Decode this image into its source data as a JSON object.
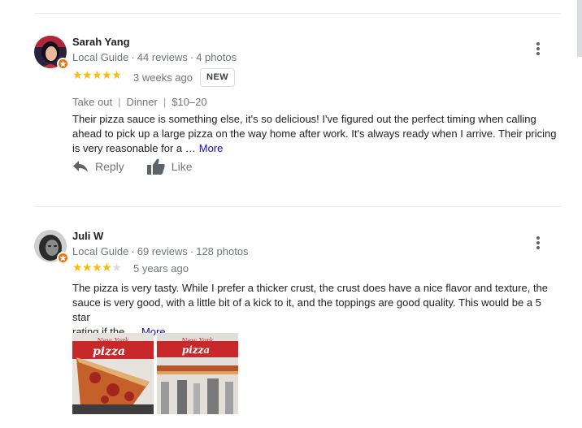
{
  "reviews": [
    {
      "name": "Sarah Yang",
      "role": "Local Guide",
      "reviews": "44 reviews",
      "photos": "4 photos",
      "stars": 5,
      "stars_text": "★★★★★",
      "age": "3 weeks ago",
      "badge": "NEW",
      "tags": [
        "Take out",
        "Dinner",
        "$10–20"
      ],
      "text_lines": [
        "Their pizza sauce is something else, it's so delicious! I've figured out the perfect timing when calling",
        "ahead to pick up a large pizza on the way home after work. It's always ready when I arrive. Their pricing",
        "is very reasonable for a …"
      ],
      "more": "More",
      "reply_label": "Reply",
      "like_label": "Like"
    },
    {
      "name": "Juli W",
      "role": "Local Guide",
      "reviews": "69 reviews",
      "photos": "128 photos",
      "stars": 4,
      "stars_on": "★★★★",
      "stars_off": "★",
      "age": "5 years ago",
      "text_lines": [
        "The pizza is very tasty. While I prefer a thicker crust, the crust does have a nice flavor and texture, the",
        "sauce is very good, with a little bit of a kick to it, and the toppings are good quality. This would be a 5 star",
        "rating if the …"
      ],
      "more": "More",
      "photo_sign_text": [
        "New York",
        "pizza"
      ]
    }
  ],
  "colors": {
    "star": "#fbbc04",
    "link": "#1a0dab",
    "muted": "#70757a",
    "guide_badge": "#e8710a"
  }
}
